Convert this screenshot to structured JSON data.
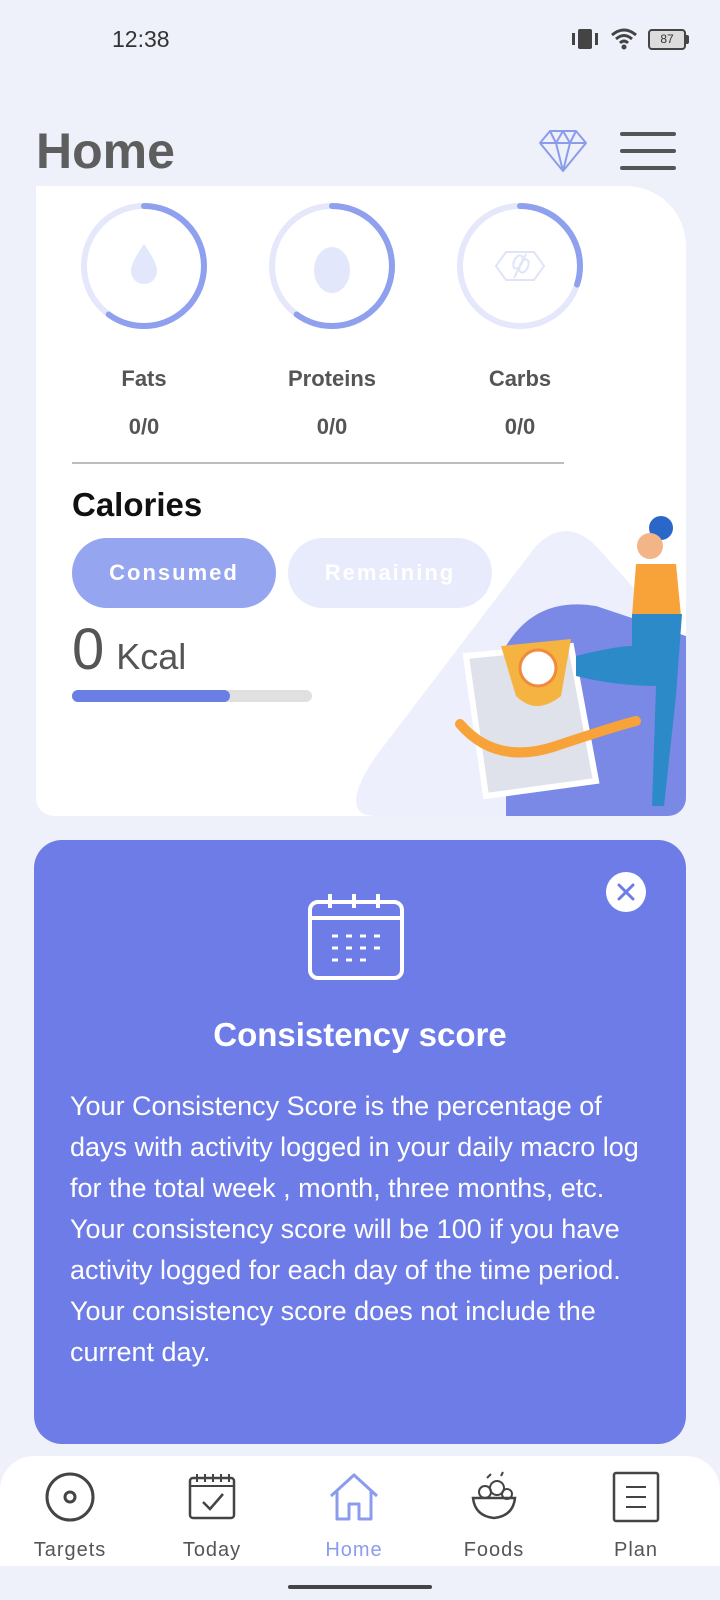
{
  "status_bar": {
    "time": "12:38",
    "battery": "87"
  },
  "header": {
    "title": "Home",
    "premium_icon": "diamond-icon",
    "menu_icon": "hamburger-menu-icon"
  },
  "macros": [
    {
      "label": "Fats",
      "value": "0/0",
      "icon": "drop-icon",
      "ring_progress": 0.6
    },
    {
      "label": "Proteins",
      "value": "0/0",
      "icon": "egg-icon",
      "ring_progress": 0.6
    },
    {
      "label": "Carbs",
      "value": "0/0",
      "icon": "wheat-icon",
      "ring_progress": 0.3
    }
  ],
  "calories": {
    "title": "Calories",
    "tabs": {
      "consumed": "Consumed",
      "remaining": "Remaining"
    },
    "value": "0",
    "unit": "Kcal",
    "progress": 0.66
  },
  "info_card": {
    "title": "Consistency score",
    "body": "Your Consistency Score is the percentage of days with activity logged in your daily macro log for the total week , month, three months, etc. Your consistency score will be 100 if you have activity logged for each day of the time period. Your consistency score does not include the current day."
  },
  "nav": {
    "items": [
      {
        "label": "Targets",
        "icon": "target-icon"
      },
      {
        "label": "Today",
        "icon": "calendar-check-icon"
      },
      {
        "label": "Home",
        "icon": "home-icon"
      },
      {
        "label": "Foods",
        "icon": "salad-bowl-icon"
      },
      {
        "label": "Plan",
        "icon": "list-icon"
      }
    ],
    "active": "Home"
  },
  "colors": {
    "accent": "#6e7ce8",
    "accent_light": "#96a5f0",
    "background": "#eef0fa"
  }
}
